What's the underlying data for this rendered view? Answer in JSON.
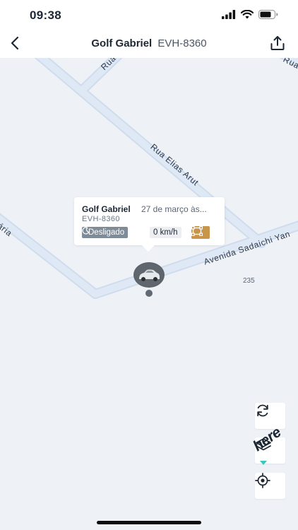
{
  "status_bar": {
    "time": "09:38",
    "icons": [
      "signal-icon",
      "wifi-icon",
      "battery-icon"
    ]
  },
  "nav": {
    "vehicle_name": "Golf Gabriel",
    "plate": "EVH-8360",
    "back_icon": "chevron-left-icon",
    "share_icon": "share-icon"
  },
  "map": {
    "streets": {
      "rua_partial": "Rua",
      "rua_top_right": "Rua",
      "rua_elias_arut": "Rua Elias Arut",
      "avenida_sadaichi": "Avenida Sadaichi Yan",
      "aria_partial": "ária"
    },
    "building_number": "235",
    "logo": "here"
  },
  "popup": {
    "vehicle_name": "Golf Gabriel",
    "datetime": "27 de março às...",
    "plate": "EVH-8360",
    "status_label": "Desligado",
    "status_icon": "moon-icon",
    "speed": "0 km/h",
    "alert_icon": "crosshair-frame-icon"
  },
  "map_controls": {
    "refresh_icon": "refresh-icon",
    "layers_icon": "layers-icon",
    "locate_icon": "locate-icon"
  },
  "colors": {
    "map_background": "#eef2f6",
    "road": "#dce6f4",
    "status_badge": "#7e8b99",
    "alert_badge": "#c8954a",
    "logo_accent": "#3cc6c3"
  }
}
